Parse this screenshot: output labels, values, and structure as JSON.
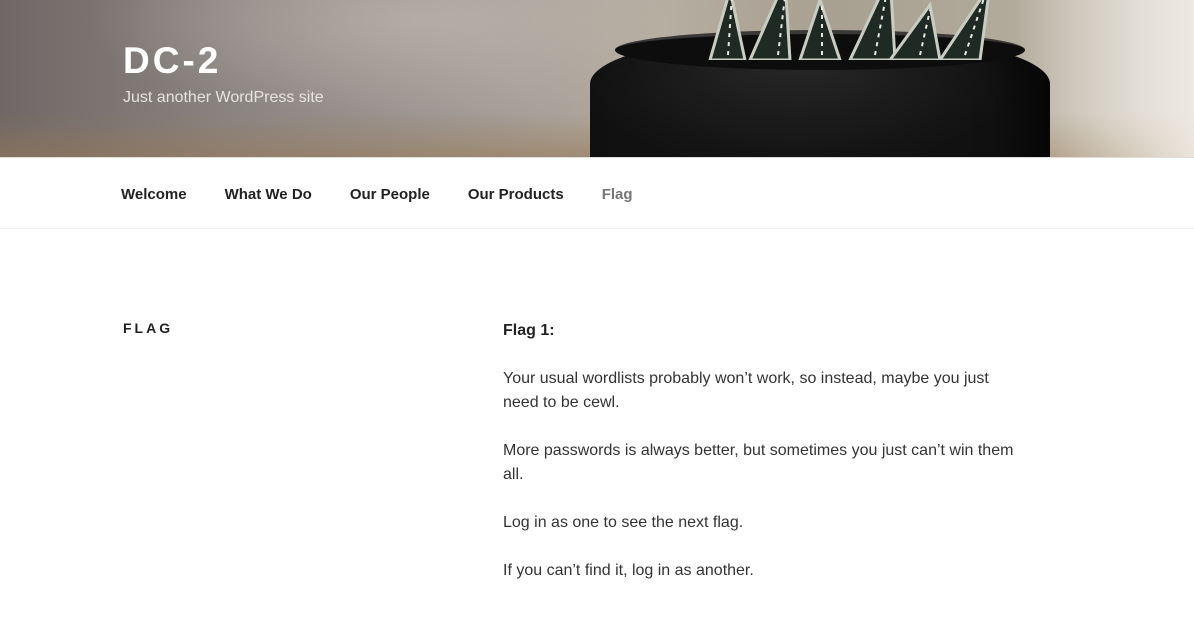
{
  "site": {
    "title": "DC-2",
    "description": "Just another WordPress site"
  },
  "nav": {
    "items": [
      {
        "label": "Welcome"
      },
      {
        "label": "What We Do"
      },
      {
        "label": "Our People"
      },
      {
        "label": "Our Products"
      },
      {
        "label": "Flag"
      }
    ],
    "current": "Flag"
  },
  "page": {
    "title": "Flag",
    "paragraphs": [
      "Flag 1:",
      "Your usual wordlists probably won’t work, so instead, maybe you just need to be cewl.",
      "More passwords is always better, but sometimes you just can’t win them all.",
      "Log in as one to see the next flag.",
      "If you can’t find it, log in as another."
    ]
  }
}
